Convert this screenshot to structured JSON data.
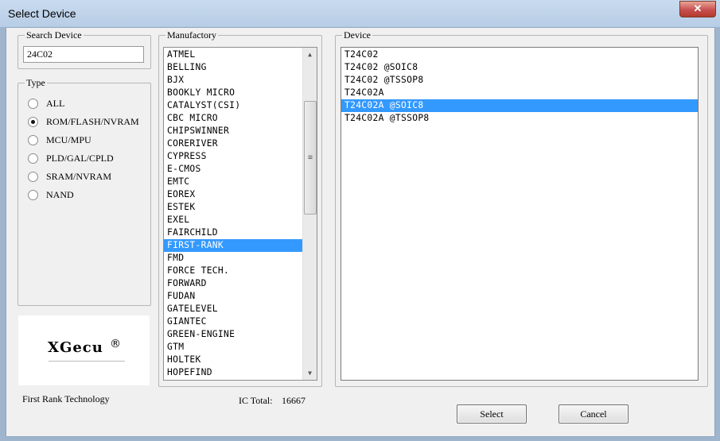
{
  "window": {
    "title": "Select Device",
    "close_label": "✕"
  },
  "search": {
    "legend": "Search Device",
    "value": "24C02"
  },
  "type_group": {
    "legend": "Type",
    "options": [
      {
        "label": "ALL",
        "selected": false
      },
      {
        "label": "ROM/FLASH/NVRAM",
        "selected": true
      },
      {
        "label": "MCU/MPU",
        "selected": false
      },
      {
        "label": "PLD/GAL/CPLD",
        "selected": false
      },
      {
        "label": "SRAM/NVRAM",
        "selected": false
      },
      {
        "label": "NAND",
        "selected": false
      }
    ]
  },
  "logo": {
    "text": "XGecu",
    "mark": "®"
  },
  "manufactory": {
    "legend": "Manufactory",
    "selected_index": 15,
    "items": [
      "ATMEL",
      "BELLING",
      "BJX",
      "BOOKLY MICRO",
      "CATALYST(CSI)",
      "CBC MICRO",
      "CHIPSWINNER",
      "CORERIVER",
      "CYPRESS",
      "E-CMOS",
      "EMTC",
      "EOREX",
      "ESTEK",
      "EXEL",
      "FAIRCHILD",
      "FIRST-RANK",
      "FMD",
      "FORCE TECH.",
      "FORWARD",
      "FUDAN",
      "GATELEVEL",
      "GIANTEC",
      "GREEN-ENGINE",
      "GTM",
      "HOLTEK",
      "HOPEFIND"
    ],
    "scroll_up_glyph": "▲",
    "scroll_down_glyph": "▼",
    "thumb_glyph": "≡"
  },
  "device": {
    "legend": "Device",
    "selected_index": 4,
    "items": [
      "T24C02",
      "T24C02 @SOIC8",
      "T24C02 @TSSOP8",
      "T24C02A",
      "T24C02A @SOIC8",
      "T24C02A @TSSOP8"
    ]
  },
  "status": {
    "manufacturer_name": "First Rank Technology",
    "ic_total_label": "IC Total:",
    "ic_total_value": "16667"
  },
  "buttons": {
    "select_label": "Select",
    "cancel_label": "Cancel"
  },
  "colors": {
    "selection": "#3399ff",
    "title_bar": "#c9dbee",
    "close_button": "#c75050"
  }
}
